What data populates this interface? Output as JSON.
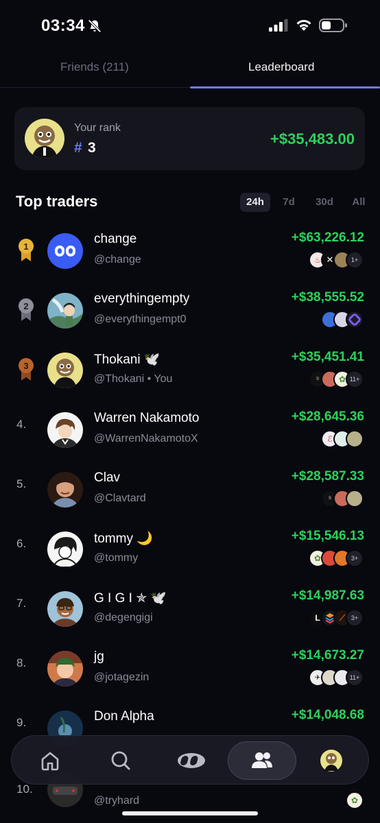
{
  "status": {
    "time": "03:34"
  },
  "tabs": [
    {
      "label": "Friends (211)",
      "active": false
    },
    {
      "label": "Leaderboard",
      "active": true
    }
  ],
  "your_rank": {
    "label": "Your rank",
    "hash": "#",
    "rank": "3",
    "pnl": "+$35,483.00"
  },
  "section_title": "Top traders",
  "filters": [
    "24h",
    "7d",
    "30d",
    "All"
  ],
  "active_filter": "24h",
  "traders": [
    {
      "rank": "1",
      "name": "change",
      "handle": "@change",
      "pnl": "+$63,226.12",
      "more": "1+"
    },
    {
      "rank": "2",
      "name": "everythingempty",
      "handle": "@everythingempt0",
      "pnl": "+$38,555.52",
      "more": ""
    },
    {
      "rank": "3",
      "name": "Thokani 🕊️",
      "handle": "@Thokani • You",
      "pnl": "+$35,451.41",
      "more": "11+"
    },
    {
      "rank": "4.",
      "name": "Warren Nakamoto",
      "handle": "@WarrenNakamotoX",
      "pnl": "+$28,645.36",
      "more": ""
    },
    {
      "rank": "5.",
      "name": "Clav",
      "handle": "@Clavtard",
      "pnl": "+$28,587.33",
      "more": ""
    },
    {
      "rank": "6.",
      "name": "tommy 🌙",
      "handle": "@tommy",
      "pnl": "+$15,546.13",
      "more": "3+"
    },
    {
      "rank": "7.",
      "name": "G I G I ✯ 🕊️",
      "handle": "@degengigi",
      "pnl": "+$14,987.63",
      "more": "3+"
    },
    {
      "rank": "8.",
      "name": "jg",
      "handle": "@jotagezin",
      "pnl": "+$14,673.27",
      "more": "11+"
    },
    {
      "rank": "9.",
      "name": "Don Alpha",
      "handle": "",
      "pnl": "+$14,048.68",
      "more": ""
    },
    {
      "rank": "10.",
      "name": "",
      "handle": "@tryhard",
      "pnl": "",
      "more": ""
    }
  ],
  "colors": {
    "accent": "#6e7cf6",
    "positive": "#2bd35a",
    "background": "#08080f",
    "card": "#15151e",
    "gold": "#d9a02a",
    "silver": "#8d8f99",
    "bronze": "#b8642b"
  },
  "nav": [
    "home-icon",
    "search-icon",
    "logo-icon",
    "friends-icon",
    "profile-avatar"
  ]
}
